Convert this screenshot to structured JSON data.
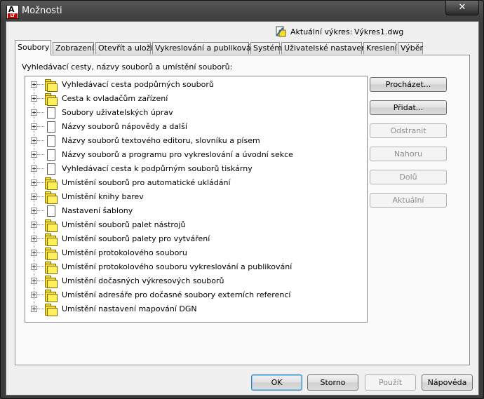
{
  "window": {
    "title": "Možnosti",
    "close_glyph": "✕"
  },
  "current_drawing": {
    "label": "Aktuální výkres:",
    "value": "Výkres1.dwg",
    "icon": "drawing-icon"
  },
  "tabs": [
    {
      "label": "Soubory",
      "active": true
    },
    {
      "label": "Zobrazení",
      "active": false
    },
    {
      "label": "Otevřít a uložit",
      "active": false
    },
    {
      "label": "Vykreslování a publikování",
      "active": false
    },
    {
      "label": "Systém",
      "active": false
    },
    {
      "label": "Uživatelské nastavení",
      "active": false
    },
    {
      "label": "Kreslení",
      "active": false
    },
    {
      "label": "Výběr",
      "active": false
    }
  ],
  "files": {
    "section_label": "Vyhledávací cesty, názvy souborů a umístění souborů:",
    "items": [
      {
        "label": "Vyhledávací cesta podpůrných souborů",
        "icon": "folder-icon"
      },
      {
        "label": "Cesta k ovladačům zařízení",
        "icon": "folder-icon"
      },
      {
        "label": "Soubory uživatelských úprav",
        "icon": "document-icon"
      },
      {
        "label": "Názvy souborů nápovědy a další",
        "icon": "document-icon"
      },
      {
        "label": "Názvy souborů textového editoru, slovníku a písem",
        "icon": "document-icon"
      },
      {
        "label": "Názvy souborů a programu pro vykreslování a úvodní sekce",
        "icon": "document-icon"
      },
      {
        "label": "Vyhledávací cesta k podpůrným souborů tiskárny",
        "icon": "document-icon"
      },
      {
        "label": "Umístění souborů pro automatické ukládání",
        "icon": "folder-icon"
      },
      {
        "label": "Umístění knihy barev",
        "icon": "folder-icon"
      },
      {
        "label": "Nastavení šablony",
        "icon": "document-icon"
      },
      {
        "label": "Umístění souborů palet nástrojů",
        "icon": "folder-icon"
      },
      {
        "label": "Umístění souborů palety pro vytváření",
        "icon": "folder-icon"
      },
      {
        "label": "Umístění protokolového souboru",
        "icon": "folder-icon"
      },
      {
        "label": "Umístění protokolového souboru vykreslování a publikování",
        "icon": "folder-icon"
      },
      {
        "label": "Umístění dočasných výkresových souborů",
        "icon": "folder-icon"
      },
      {
        "label": "Umístění adresáře pro dočasné soubory externích referencí",
        "icon": "folder-icon"
      },
      {
        "label": "Umístění nastavení mapování DGN",
        "icon": "folder-icon"
      }
    ]
  },
  "side_buttons": {
    "browse": "Procházet...",
    "add": "Přidat...",
    "remove": "Odstranit",
    "move_up": "Nahoru",
    "move_down": "Dolů",
    "set_current": "Aktuální"
  },
  "bottom_buttons": {
    "ok": "OK",
    "cancel": "Storno",
    "apply": "Použít",
    "help": "Nápověda"
  },
  "colors": {
    "folder": "#f5de2c",
    "title_bar": "#3c3c3c",
    "panel": "#f0f0f0"
  }
}
